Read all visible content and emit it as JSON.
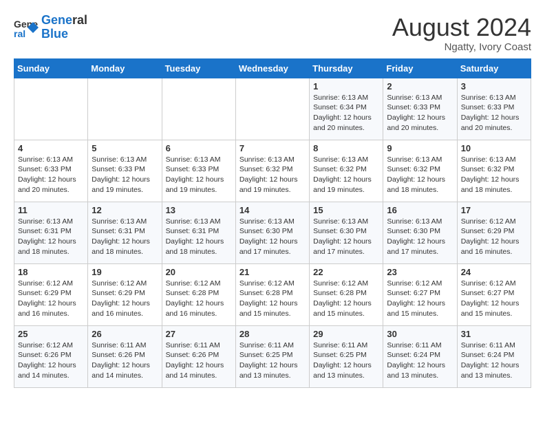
{
  "header": {
    "logo_line1": "General",
    "logo_line2": "Blue",
    "month_title": "August 2024",
    "subtitle": "Ngatty, Ivory Coast"
  },
  "days_of_week": [
    "Sunday",
    "Monday",
    "Tuesday",
    "Wednesday",
    "Thursday",
    "Friday",
    "Saturday"
  ],
  "weeks": [
    [
      {
        "day": "",
        "detail": ""
      },
      {
        "day": "",
        "detail": ""
      },
      {
        "day": "",
        "detail": ""
      },
      {
        "day": "",
        "detail": ""
      },
      {
        "day": "1",
        "detail": "Sunrise: 6:13 AM\nSunset: 6:34 PM\nDaylight: 12 hours\nand 20 minutes."
      },
      {
        "day": "2",
        "detail": "Sunrise: 6:13 AM\nSunset: 6:33 PM\nDaylight: 12 hours\nand 20 minutes."
      },
      {
        "day": "3",
        "detail": "Sunrise: 6:13 AM\nSunset: 6:33 PM\nDaylight: 12 hours\nand 20 minutes."
      }
    ],
    [
      {
        "day": "4",
        "detail": "Sunrise: 6:13 AM\nSunset: 6:33 PM\nDaylight: 12 hours\nand 20 minutes."
      },
      {
        "day": "5",
        "detail": "Sunrise: 6:13 AM\nSunset: 6:33 PM\nDaylight: 12 hours\nand 19 minutes."
      },
      {
        "day": "6",
        "detail": "Sunrise: 6:13 AM\nSunset: 6:33 PM\nDaylight: 12 hours\nand 19 minutes."
      },
      {
        "day": "7",
        "detail": "Sunrise: 6:13 AM\nSunset: 6:32 PM\nDaylight: 12 hours\nand 19 minutes."
      },
      {
        "day": "8",
        "detail": "Sunrise: 6:13 AM\nSunset: 6:32 PM\nDaylight: 12 hours\nand 19 minutes."
      },
      {
        "day": "9",
        "detail": "Sunrise: 6:13 AM\nSunset: 6:32 PM\nDaylight: 12 hours\nand 18 minutes."
      },
      {
        "day": "10",
        "detail": "Sunrise: 6:13 AM\nSunset: 6:32 PM\nDaylight: 12 hours\nand 18 minutes."
      }
    ],
    [
      {
        "day": "11",
        "detail": "Sunrise: 6:13 AM\nSunset: 6:31 PM\nDaylight: 12 hours\nand 18 minutes."
      },
      {
        "day": "12",
        "detail": "Sunrise: 6:13 AM\nSunset: 6:31 PM\nDaylight: 12 hours\nand 18 minutes."
      },
      {
        "day": "13",
        "detail": "Sunrise: 6:13 AM\nSunset: 6:31 PM\nDaylight: 12 hours\nand 18 minutes."
      },
      {
        "day": "14",
        "detail": "Sunrise: 6:13 AM\nSunset: 6:30 PM\nDaylight: 12 hours\nand 17 minutes."
      },
      {
        "day": "15",
        "detail": "Sunrise: 6:13 AM\nSunset: 6:30 PM\nDaylight: 12 hours\nand 17 minutes."
      },
      {
        "day": "16",
        "detail": "Sunrise: 6:13 AM\nSunset: 6:30 PM\nDaylight: 12 hours\nand 17 minutes."
      },
      {
        "day": "17",
        "detail": "Sunrise: 6:12 AM\nSunset: 6:29 PM\nDaylight: 12 hours\nand 16 minutes."
      }
    ],
    [
      {
        "day": "18",
        "detail": "Sunrise: 6:12 AM\nSunset: 6:29 PM\nDaylight: 12 hours\nand 16 minutes."
      },
      {
        "day": "19",
        "detail": "Sunrise: 6:12 AM\nSunset: 6:29 PM\nDaylight: 12 hours\nand 16 minutes."
      },
      {
        "day": "20",
        "detail": "Sunrise: 6:12 AM\nSunset: 6:28 PM\nDaylight: 12 hours\nand 16 minutes."
      },
      {
        "day": "21",
        "detail": "Sunrise: 6:12 AM\nSunset: 6:28 PM\nDaylight: 12 hours\nand 15 minutes."
      },
      {
        "day": "22",
        "detail": "Sunrise: 6:12 AM\nSunset: 6:28 PM\nDaylight: 12 hours\nand 15 minutes."
      },
      {
        "day": "23",
        "detail": "Sunrise: 6:12 AM\nSunset: 6:27 PM\nDaylight: 12 hours\nand 15 minutes."
      },
      {
        "day": "24",
        "detail": "Sunrise: 6:12 AM\nSunset: 6:27 PM\nDaylight: 12 hours\nand 15 minutes."
      }
    ],
    [
      {
        "day": "25",
        "detail": "Sunrise: 6:12 AM\nSunset: 6:26 PM\nDaylight: 12 hours\nand 14 minutes."
      },
      {
        "day": "26",
        "detail": "Sunrise: 6:11 AM\nSunset: 6:26 PM\nDaylight: 12 hours\nand 14 minutes."
      },
      {
        "day": "27",
        "detail": "Sunrise: 6:11 AM\nSunset: 6:26 PM\nDaylight: 12 hours\nand 14 minutes."
      },
      {
        "day": "28",
        "detail": "Sunrise: 6:11 AM\nSunset: 6:25 PM\nDaylight: 12 hours\nand 13 minutes."
      },
      {
        "day": "29",
        "detail": "Sunrise: 6:11 AM\nSunset: 6:25 PM\nDaylight: 12 hours\nand 13 minutes."
      },
      {
        "day": "30",
        "detail": "Sunrise: 6:11 AM\nSunset: 6:24 PM\nDaylight: 12 hours\nand 13 minutes."
      },
      {
        "day": "31",
        "detail": "Sunrise: 6:11 AM\nSunset: 6:24 PM\nDaylight: 12 hours\nand 13 minutes."
      }
    ]
  ]
}
